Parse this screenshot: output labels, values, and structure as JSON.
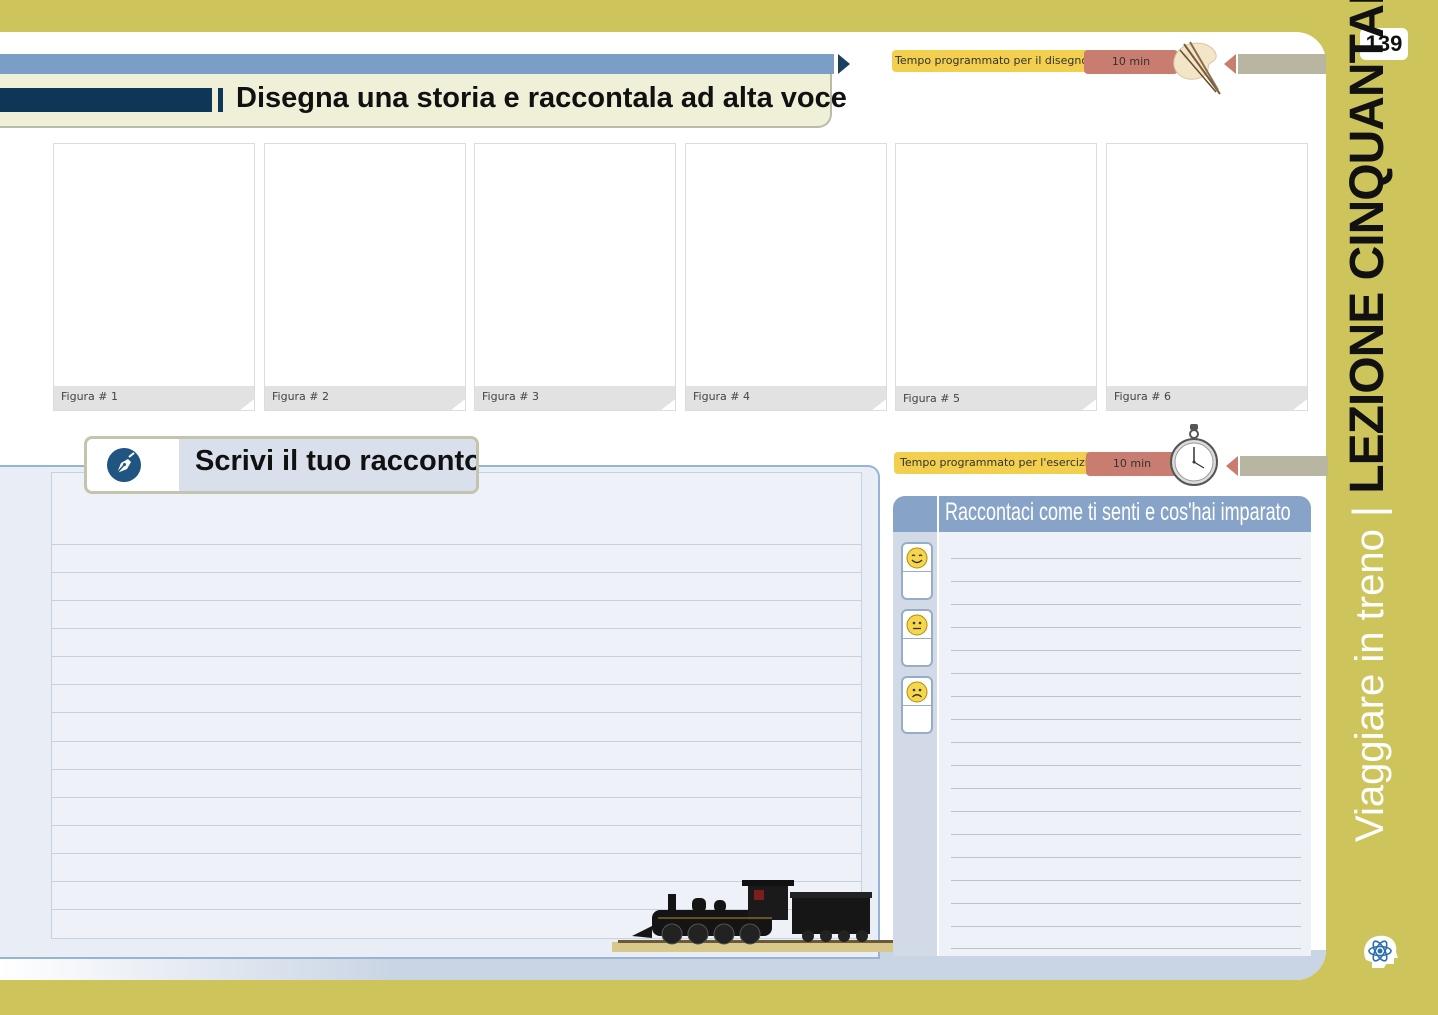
{
  "page_number": "139",
  "lesson": {
    "subtitle": "Viaggiare in treno",
    "separator": "|",
    "title": "LEZIONE CINQUANTADUE"
  },
  "header": {
    "title": "Disegna una storia e raccontala ad alta voce"
  },
  "drawing_timer": {
    "label": "Tempo programmato per il disegno:",
    "value": "10 min",
    "icon": "paint-palette-icon"
  },
  "frames": [
    {
      "caption": "Figura # 1"
    },
    {
      "caption": "Figura # 2"
    },
    {
      "caption": "Figura # 3"
    },
    {
      "caption": "Figura # 4"
    },
    {
      "caption": "Figura # 5"
    },
    {
      "caption": "Figura # 6"
    }
  ],
  "story": {
    "title": "Scrivi il tuo racconto",
    "icon": "pen-nib-icon"
  },
  "exercise_timer": {
    "label": "Tempo programmato per l'esercizio:",
    "value": "10 min",
    "icon": "stopwatch-icon"
  },
  "reflection": {
    "title": "Raccontaci come ti senti e cos'hai imparato",
    "moods": [
      "happy-face-icon",
      "neutral-face-icon",
      "sad-face-icon"
    ]
  },
  "colors": {
    "background_olive": "#cec45c",
    "navy": "#0e3757",
    "header_blue": "#7a9ec6",
    "timer_yellow": "#f3cf4f",
    "timer_red": "#c87d70"
  }
}
